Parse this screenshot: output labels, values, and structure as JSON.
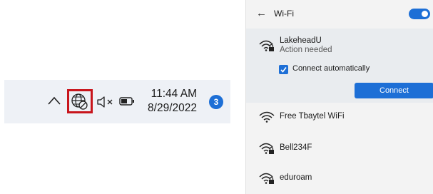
{
  "taskbar": {
    "time": "11:44 AM",
    "date": "8/29/2022",
    "notification_count": "3",
    "icons": [
      "chevron-up-icon",
      "globe-no-internet-icon",
      "volume-muted-icon",
      "battery-icon"
    ],
    "highlight_color": "#c8151c"
  },
  "wifi_panel": {
    "title": "Wi-Fi",
    "toggle_on": true,
    "connected_network": {
      "name": "LakeheadU",
      "status": "Action needed",
      "checkbox_label": "Connect automatically",
      "checkbox_checked": true,
      "connect_label": "Connect"
    },
    "networks": [
      {
        "name": "Free Tbaytel WiFi",
        "secured": false
      },
      {
        "name": "Bell234F",
        "secured": true
      },
      {
        "name": "eduroam",
        "secured": true
      }
    ],
    "accent_color": "#1d6fd6"
  }
}
